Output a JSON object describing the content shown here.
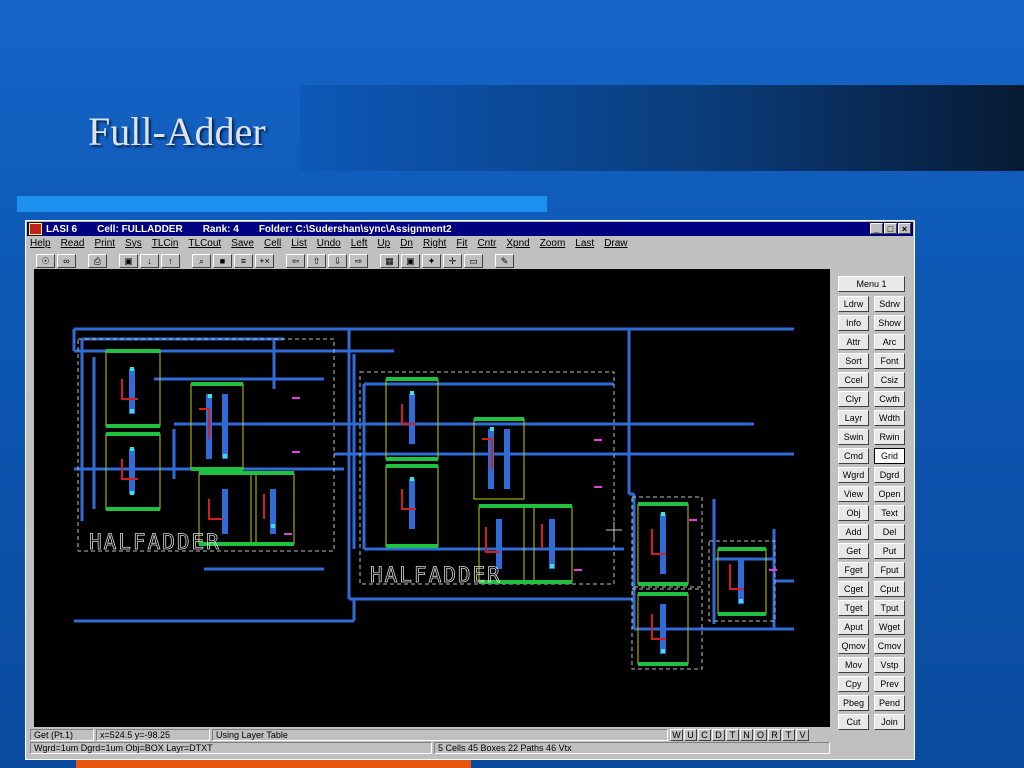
{
  "slide": {
    "title": "Full-Adder"
  },
  "window": {
    "title_app": "LASI 6",
    "title_cell": "Cell: FULLADDER",
    "title_rank": "Rank: 4",
    "title_folder": "Folder: C:\\Sudershan\\sync\\Assignment2",
    "controls": [
      "_",
      "□",
      "×"
    ]
  },
  "menu": [
    "Help",
    "Read",
    "Print",
    "Sys",
    "TLCin",
    "TLCout",
    "Save",
    "Cell",
    "List",
    "Undo",
    "Left",
    "Up",
    "Dn",
    "Right",
    "Fit",
    "Cntr",
    "Xpnd",
    "Zoom",
    "Last",
    "Draw"
  ],
  "toolbar": [
    {
      "icon": "lightbulb-icon",
      "glyph": "☉"
    },
    {
      "icon": "glasses-icon",
      "glyph": "∞"
    },
    {
      "icon": "printer-icon",
      "glyph": "⎙"
    },
    {
      "icon": "window-icon",
      "glyph": "▣"
    },
    {
      "icon": "tlc-in-icon",
      "glyph": "↓"
    },
    {
      "icon": "tlc-out-icon",
      "glyph": "↑"
    },
    {
      "icon": "zoom-icon",
      "glyph": "⌕"
    },
    {
      "icon": "save-icon",
      "glyph": "■"
    },
    {
      "icon": "list-icon",
      "glyph": "≡"
    },
    {
      "icon": "cross-icon",
      "glyph": "+×"
    },
    {
      "icon": "arrow-left-icon",
      "glyph": "⇦"
    },
    {
      "icon": "arrow-up-icon",
      "glyph": "⇧"
    },
    {
      "icon": "arrow-down-icon",
      "glyph": "⇩"
    },
    {
      "icon": "arrow-right-icon",
      "glyph": "⇨"
    },
    {
      "icon": "fit-icon",
      "glyph": "▦"
    },
    {
      "icon": "center-icon",
      "glyph": "▣"
    },
    {
      "icon": "expand-icon",
      "glyph": "✦"
    },
    {
      "icon": "move-icon",
      "glyph": "✛"
    },
    {
      "icon": "last-icon",
      "glyph": "▭"
    },
    {
      "icon": "draw-pencil-icon",
      "glyph": "✎"
    }
  ],
  "side_menu": {
    "menu_label": "Menu 1",
    "buttons": [
      [
        "Ldrw",
        "Sdrw"
      ],
      [
        "Info",
        "Show"
      ],
      [
        "Attr",
        "Arc"
      ],
      [
        "Sort",
        "Font"
      ],
      [
        "Ccel",
        "Csiz"
      ],
      [
        "Clyr",
        "Cwth"
      ],
      [
        "Layr",
        "Wdth"
      ],
      [
        "Swin",
        "Rwin"
      ],
      [
        "Cmd",
        "Grid"
      ],
      [
        "Wgrd",
        "Dgrd"
      ],
      [
        "View",
        "Open"
      ],
      [
        "Obj",
        "Text"
      ],
      [
        "Add",
        "Del"
      ],
      [
        "Get",
        "Put"
      ],
      [
        "Fget",
        "Fput"
      ],
      [
        "Cget",
        "Cput"
      ],
      [
        "Tget",
        "Tput"
      ],
      [
        "Aput",
        "Wget"
      ],
      [
        "Qmov",
        "Cmov"
      ],
      [
        "Mov",
        "Vstp"
      ],
      [
        "Cpy",
        "Prev"
      ],
      [
        "Pbeg",
        "Pend"
      ],
      [
        "Cut",
        "Join"
      ]
    ],
    "active": "Grid"
  },
  "status": {
    "command": "Get (Pt.1)",
    "coords": "x=524.5  y=-98.25",
    "layer_table": "Using Layer Table",
    "flags": [
      "W",
      "U",
      "C",
      "D",
      "T",
      "N",
      "O",
      "R",
      "T",
      "V"
    ],
    "settings": "Wgrd=1um  Dgrd=1um  Obj=BOX  Layr=DTXT",
    "counts": "5 Cells  45 Boxes  22 Paths  46 Vtx"
  },
  "layout_labels": [
    "HALFADDER",
    "HALFADDER"
  ],
  "colors": {
    "wire_blue": "#2f6cd8",
    "cell_yellow": "#c8c800",
    "metal_green": "#20c040",
    "poly_red": "#d02020",
    "contact_cyan": "#40e0e0",
    "text_magenta": "#e040e0"
  }
}
